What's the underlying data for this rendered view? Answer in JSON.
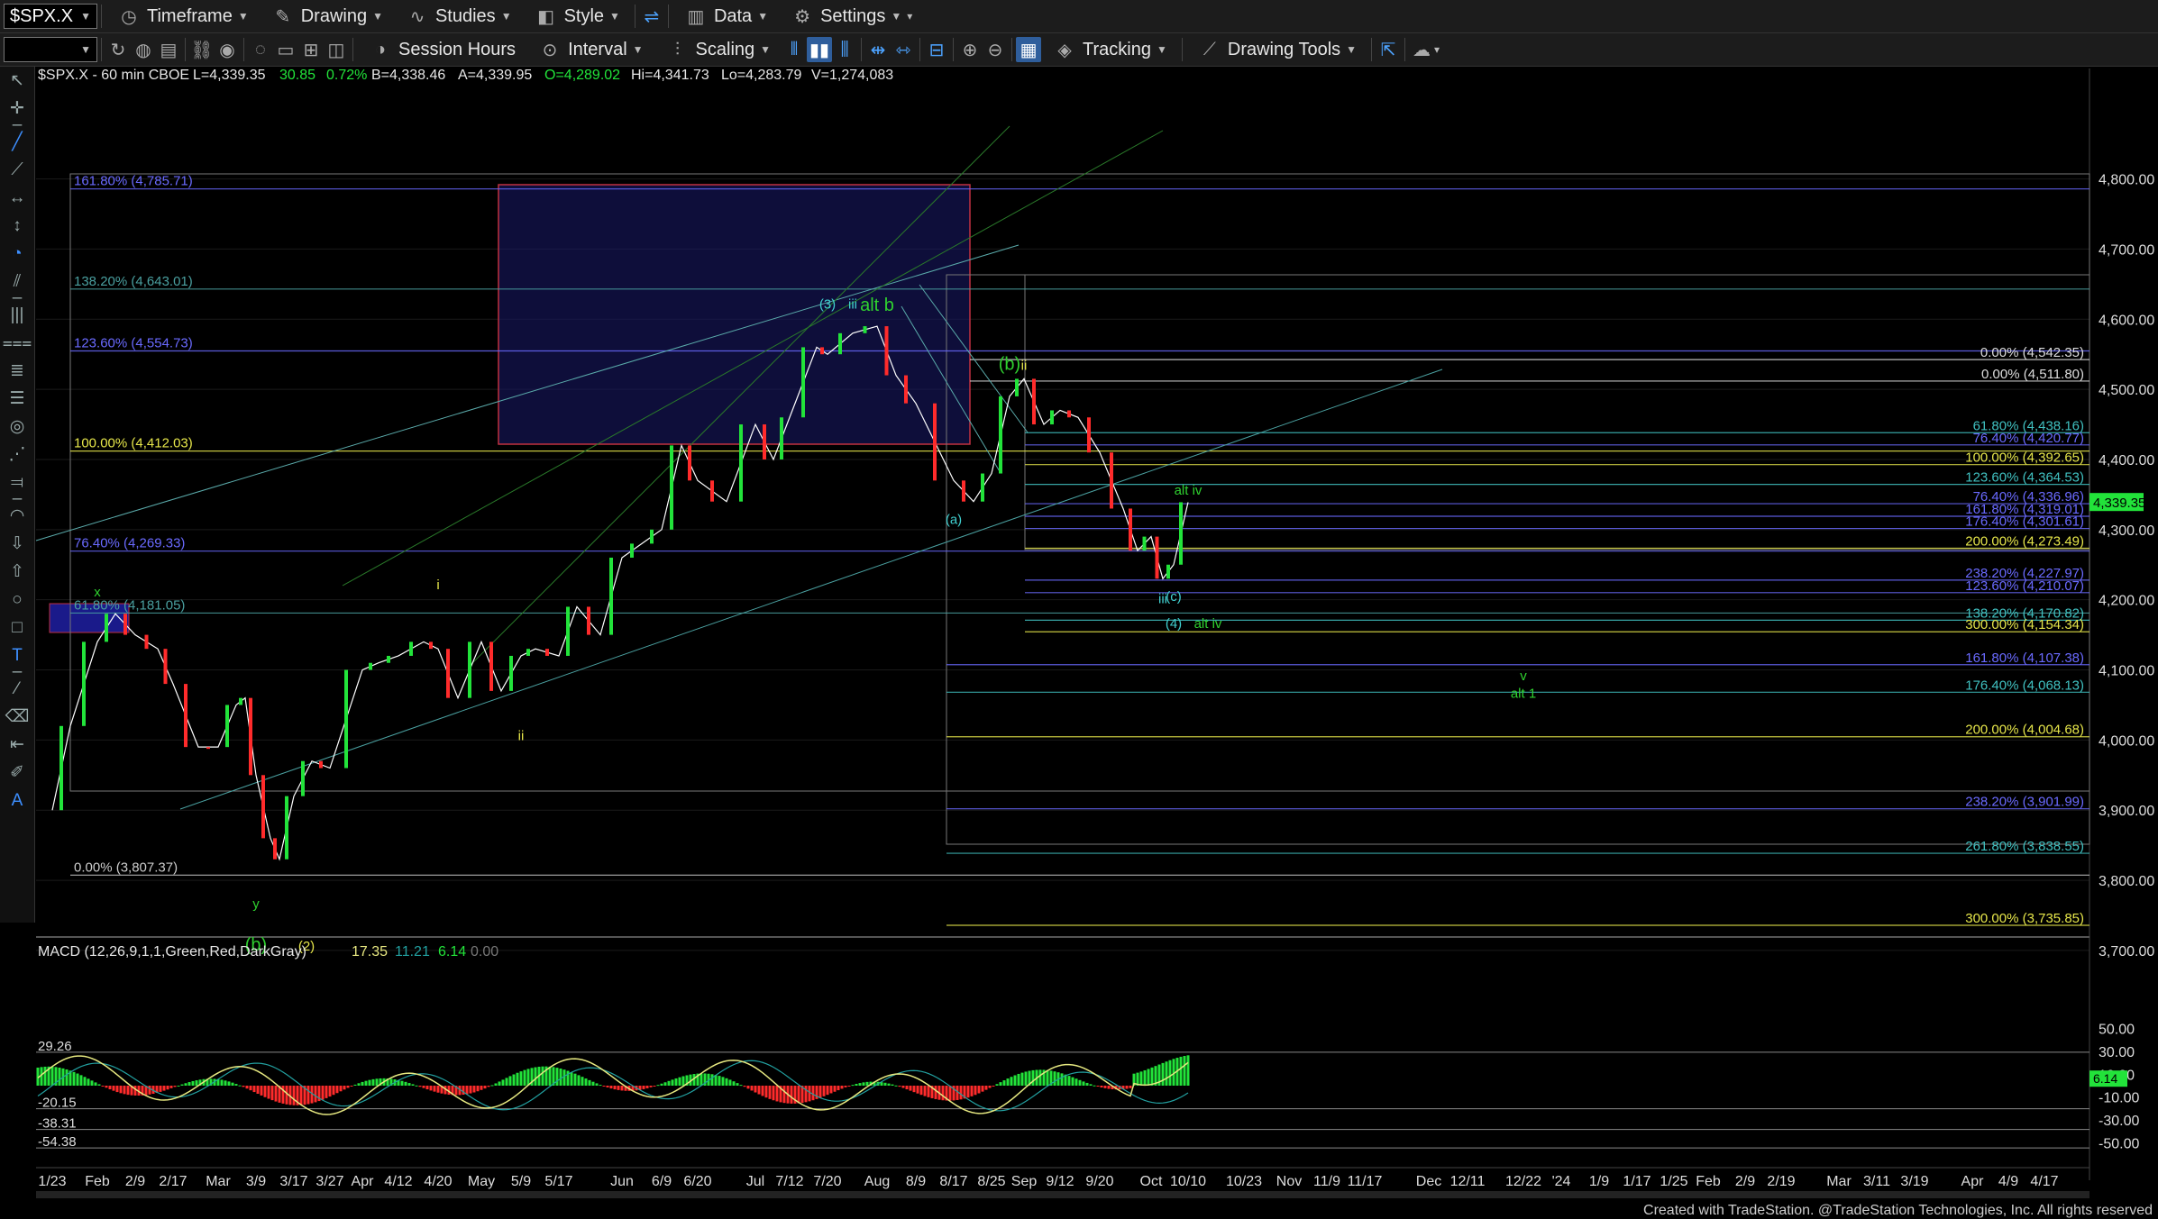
{
  "toolbar": {
    "symbol": "$SPX.X",
    "timeframe_label": "Timeframe",
    "drawing_label": "Drawing",
    "studies_label": "Studies",
    "style_label": "Style",
    "data_label": "Data",
    "settings_label": "Settings",
    "session_hours_label": "Session Hours",
    "interval_label": "Interval",
    "scaling_label": "Scaling",
    "tracking_label": "Tracking",
    "drawing_tools_label": "Drawing Tools"
  },
  "header": {
    "title": "$SPX.X - 60 min  CBOE",
    "last": "L=4,339.35",
    "change": "30.85",
    "change_pct": "0.72%",
    "bid": "B=4,338.46",
    "ask": "A=4,339.95",
    "open": "O=4,289.02",
    "high": "Hi=4,341.73",
    "low": "Lo=4,283.79",
    "volume": "V=1,274,083"
  },
  "macd_header": {
    "label": "MACD (12,26,9,1,1,Green,Red,DarkGray)",
    "v1": "17.35",
    "v2": "11.21",
    "v3": "6.14",
    "v4": "0.00"
  },
  "footer": {
    "credit": "Created with TradeStation. @TradeStation Technologies, Inc. All rights reserved"
  },
  "chart_data": [
    {
      "type": "line",
      "name": "price",
      "ylim": [
        3650,
        4830
      ],
      "y_ticks": [
        "4,800.00",
        "4,700.00",
        "4,600.00",
        "4,500.00",
        "4,400.00",
        "4,300.00",
        "4,200.00",
        "4,100.00",
        "4,000.00",
        "3,900.00",
        "3,800.00",
        "3,700.00"
      ],
      "last_price_label": "4,339.35",
      "x_ticks": [
        "1/23",
        "Feb",
        "2/9",
        "2/17",
        "Mar",
        "3/9",
        "3/17",
        "3/27",
        "Apr",
        "4/12",
        "4/20",
        "May",
        "5/9",
        "5/17",
        "Jun",
        "6/9",
        "6/20",
        "Jul",
        "7/12",
        "7/20",
        "Aug",
        "8/9",
        "8/17",
        "8/25",
        "Sep",
        "9/12",
        "9/20",
        "Oct",
        "10/10",
        "10/23",
        "Nov",
        "11/9",
        "11/17",
        "Dec",
        "12/11",
        "12/22",
        "'24",
        "1/9",
        "1/17",
        "1/25",
        "Feb",
        "2/9",
        "2/19",
        "Mar",
        "3/11",
        "3/19",
        "Apr",
        "4/9",
        "4/17"
      ],
      "price_path": [
        [
          "1/23",
          3900
        ],
        [
          "1/27",
          4020
        ],
        [
          "Feb",
          4140
        ],
        [
          "2/3",
          4180
        ],
        [
          "2/9",
          4150
        ],
        [
          "2/14",
          4130
        ],
        [
          "2/17",
          4080
        ],
        [
          "2/23",
          3990
        ],
        [
          "Mar",
          3990
        ],
        [
          "3/3",
          4050
        ],
        [
          "3/6",
          4060
        ],
        [
          "3/9",
          3950
        ],
        [
          "3/13",
          3860
        ],
        [
          "3/15",
          3830
        ],
        [
          "3/17",
          3920
        ],
        [
          "3/22",
          3970
        ],
        [
          "3/27",
          3960
        ],
        [
          "Apr",
          4100
        ],
        [
          "4/5",
          4110
        ],
        [
          "4/12",
          4120
        ],
        [
          "4/17",
          4140
        ],
        [
          "4/20",
          4130
        ],
        [
          "4/26",
          4060
        ],
        [
          "May",
          4140
        ],
        [
          "5/4",
          4070
        ],
        [
          "5/9",
          4120
        ],
        [
          "5/12",
          4130
        ],
        [
          "5/17",
          4120
        ],
        [
          "5/19",
          4190
        ],
        [
          "5/24",
          4150
        ],
        [
          "Jun",
          4260
        ],
        [
          "6/5",
          4280
        ],
        [
          "6/9",
          4300
        ],
        [
          "6/15",
          4420
        ],
        [
          "6/20",
          4370
        ],
        [
          "6/26",
          4340
        ],
        [
          "Jul",
          4450
        ],
        [
          "7/6",
          4400
        ],
        [
          "7/12",
          4460
        ],
        [
          "7/18",
          4560
        ],
        [
          "7/20",
          4550
        ],
        [
          "7/26",
          4580
        ],
        [
          "Aug",
          4590
        ],
        [
          "8/3",
          4520
        ],
        [
          "8/9",
          4480
        ],
        [
          "8/17",
          4370
        ],
        [
          "8/21",
          4340
        ],
        [
          "8/25",
          4380
        ],
        [
          "8/29",
          4490
        ],
        [
          "Sep",
          4515
        ],
        [
          "9/6",
          4450
        ],
        [
          "9/12",
          4470
        ],
        [
          "9/15",
          4460
        ],
        [
          "9/20",
          4410
        ],
        [
          "9/25",
          4330
        ],
        [
          "9/28",
          4270
        ],
        [
          "Oct",
          4290
        ],
        [
          "10/3",
          4230
        ],
        [
          "10/6",
          4250
        ],
        [
          "10/10",
          4339
        ]
      ],
      "fib_lines": [
        {
          "label": "161.80% (4,785.71)",
          "value": 4785.71
        },
        {
          "label": "138.20% (4,643.01)",
          "value": 4643.01
        },
        {
          "label": "123.60% (4,554.73)",
          "value": 4554.73
        },
        {
          "label": "100.00% (4,412.03)",
          "value": 4412.03
        },
        {
          "label": "76.40% (4,269.33)",
          "value": 4269.33
        },
        {
          "label": "61.80% (4,181.05)",
          "value": 4181.05
        },
        {
          "label": "0.00% (3,807.37)",
          "value": 3807.37
        }
      ],
      "right_fibs": [
        {
          "label": "0.00% (4,542.35)",
          "value": 4542.35
        },
        {
          "label": "0.00% (4,511.80)",
          "value": 4511.8
        },
        {
          "label": "61.80% (4,438.16)",
          "value": 4438.16
        },
        {
          "label": "76.40% (4,420.77)",
          "value": 4420.77
        },
        {
          "label": "100.00% (4,392.65)",
          "value": 4392.65
        },
        {
          "label": "123.60% (4,364.53)",
          "value": 4364.53
        },
        {
          "label": "76.40% (4,336.96)",
          "value": 4336.96
        },
        {
          "label": "161.80% (4,319.01)",
          "value": 4319.01
        },
        {
          "label": "176.40% (4,301.61)",
          "value": 4301.61
        },
        {
          "label": "200.00% (4,273.49)",
          "value": 4273.49
        },
        {
          "label": "238.20% (4,227.97)",
          "value": 4227.97
        },
        {
          "label": "123.60% (4,210.07)",
          "value": 4210.07
        },
        {
          "label": "138.20% (4,170.82)",
          "value": 4170.82
        },
        {
          "label": "300.00% (4,154.34)",
          "value": 4154.34
        },
        {
          "label": "161.80% (4,107.38)",
          "value": 4107.38
        },
        {
          "label": "176.40% (4,068.13)",
          "value": 4068.13
        },
        {
          "label": "200.00% (4,004.68)",
          "value": 4004.68
        },
        {
          "label": "238.20% (3,901.99)",
          "value": 3901.99
        },
        {
          "label": "261.80% (3,838.55)",
          "value": 3838.55
        },
        {
          "label": "300.00% (3,735.85)",
          "value": 3735.85
        }
      ],
      "wave_labels": [
        {
          "text": "x",
          "x": "Feb",
          "y": 4205
        },
        {
          "text": "i",
          "x": "4/20",
          "y": 4215
        },
        {
          "text": "ii",
          "x": "5/9",
          "y": 4000
        },
        {
          "text": "y",
          "x": "3/9",
          "y": 3760
        },
        {
          "text": "(b)",
          "x": "3/9",
          "y": 3700
        },
        {
          "text": "(2)",
          "x": "3/17",
          "y": 3700
        },
        {
          "text": "(3)",
          "x": "7/20",
          "y": 4615
        },
        {
          "text": "iii",
          "x": "7/26",
          "y": 4615
        },
        {
          "text": "alt b",
          "x": "Aug",
          "y": 4612
        },
        {
          "text": "(b)",
          "x": "8/29",
          "y": 4528
        },
        {
          "text": "ii",
          "x": "Sep",
          "y": 4528
        },
        {
          "text": "(a)",
          "x": "8/17",
          "y": 4308
        },
        {
          "text": "alt iv",
          "x": "10/10",
          "y": 4350
        },
        {
          "text": "iii",
          "x": "10/3",
          "y": 4195
        },
        {
          "text": "(c)",
          "x": "10/6",
          "y": 4198
        },
        {
          "text": "(4)",
          "x": "10/6",
          "y": 4160
        },
        {
          "text": "alt iv",
          "x": "10/10",
          "y": 4160
        },
        {
          "text": "v",
          "x": "12/22",
          "y": 4085
        },
        {
          "text": "alt 1",
          "x": "12/22",
          "y": 4060
        }
      ]
    },
    {
      "type": "line",
      "name": "MACD",
      "ylim": [
        -58,
        58
      ],
      "y_ticks": [
        "50.00",
        "30.00",
        "10.00",
        "-10.00",
        "-30.00",
        "-50.00"
      ],
      "level_labels": [
        {
          "text": "29.26",
          "value": 29.26
        },
        {
          "text": "-20.15",
          "value": -20.15
        },
        {
          "text": "-38.31",
          "value": -38.31
        },
        {
          "text": "-54.38",
          "value": -54.38
        }
      ],
      "last_value_label": "6.14"
    }
  ],
  "colors": {
    "up": "#22e33a",
    "down": "#ff2b2b",
    "macd": "#e6e880",
    "signal": "#22a0a0",
    "fib_left": "#6a6aff",
    "fib_right_yellow": "#e6e64a",
    "fib_right_teal": "#40c0c0",
    "wave_green": "#2fd12f",
    "wave_yellow": "#e6e64a",
    "wave_teal": "#40d0d0",
    "box": "#1a1a6a"
  }
}
